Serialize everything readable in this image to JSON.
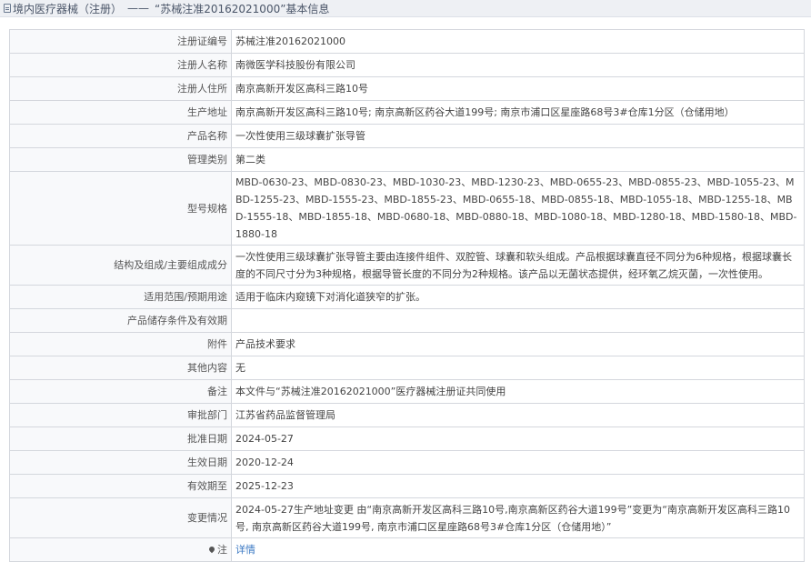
{
  "header": {
    "prefix": "境内医疗器械（注册）",
    "separator": "——",
    "title": "“苏械注准20162021000”基本信息"
  },
  "rows": [
    {
      "label": "注册证编号",
      "value": "苏械注准20162021000"
    },
    {
      "label": "注册人名称",
      "value": "南微医学科技股份有限公司"
    },
    {
      "label": "注册人住所",
      "value": "南京高新开发区高科三路10号"
    },
    {
      "label": "生产地址",
      "value": "南京高新开发区高科三路10号; 南京高新区药谷大道199号; 南京市浦口区星座路68号3#仓库1分区（仓储用地）"
    },
    {
      "label": "产品名称",
      "value": "一次性使用三级球囊扩张导管"
    },
    {
      "label": "管理类别",
      "value": "第二类"
    },
    {
      "label": "型号规格",
      "value": "MBD-0630-23、MBD-0830-23、MBD-1030-23、MBD-1230-23、MBD-0655-23、MBD-0855-23、MBD-1055-23、MBD-1255-23、MBD-1555-23、MBD-1855-23、MBD-0655-18、MBD-0855-18、MBD-1055-18、MBD-1255-18、MBD-1555-18、MBD-1855-18、MBD-0680-18、MBD-0880-18、MBD-1080-18、MBD-1280-18、MBD-1580-18、MBD-1880-18"
    },
    {
      "label": "结构及组成/主要组成成分",
      "value": "一次性使用三级球囊扩张导管主要由连接件组件、双腔管、球囊和软头组成。产品根据球囊直径不同分为6种规格，根据球囊长度的不同尺寸分为3种规格，根据导管长度的不同分为2种规格。该产品以无菌状态提供，经环氧乙烷灭菌，一次性使用。"
    },
    {
      "label": "适用范围/预期用途",
      "value": "适用于临床内窥镜下对消化道狭窄的扩张。"
    },
    {
      "label": "产品储存条件及有效期",
      "value": ""
    },
    {
      "label": "附件",
      "value": "产品技术要求"
    },
    {
      "label": "其他内容",
      "value": "无"
    },
    {
      "label": "备注",
      "value": "本文件与“苏械注准20162021000”医疗器械注册证共同使用"
    },
    {
      "label": "审批部门",
      "value": "江苏省药品监督管理局"
    },
    {
      "label": "批准日期",
      "value": "2024-05-27"
    },
    {
      "label": "生效日期",
      "value": "2020-12-24"
    },
    {
      "label": "有效期至",
      "value": "2025-12-23"
    },
    {
      "label": "变更情况",
      "value": "2024-05-27生产地址变更 由“南京高新开发区高科三路10号,南京高新区药谷大道199号”变更为“南京高新开发区高科三路10号, 南京高新区药谷大道199号, 南京市浦口区星座路68号3#仓库1分区（仓储用地）”"
    },
    {
      "label": "注",
      "value": "详情"
    }
  ]
}
